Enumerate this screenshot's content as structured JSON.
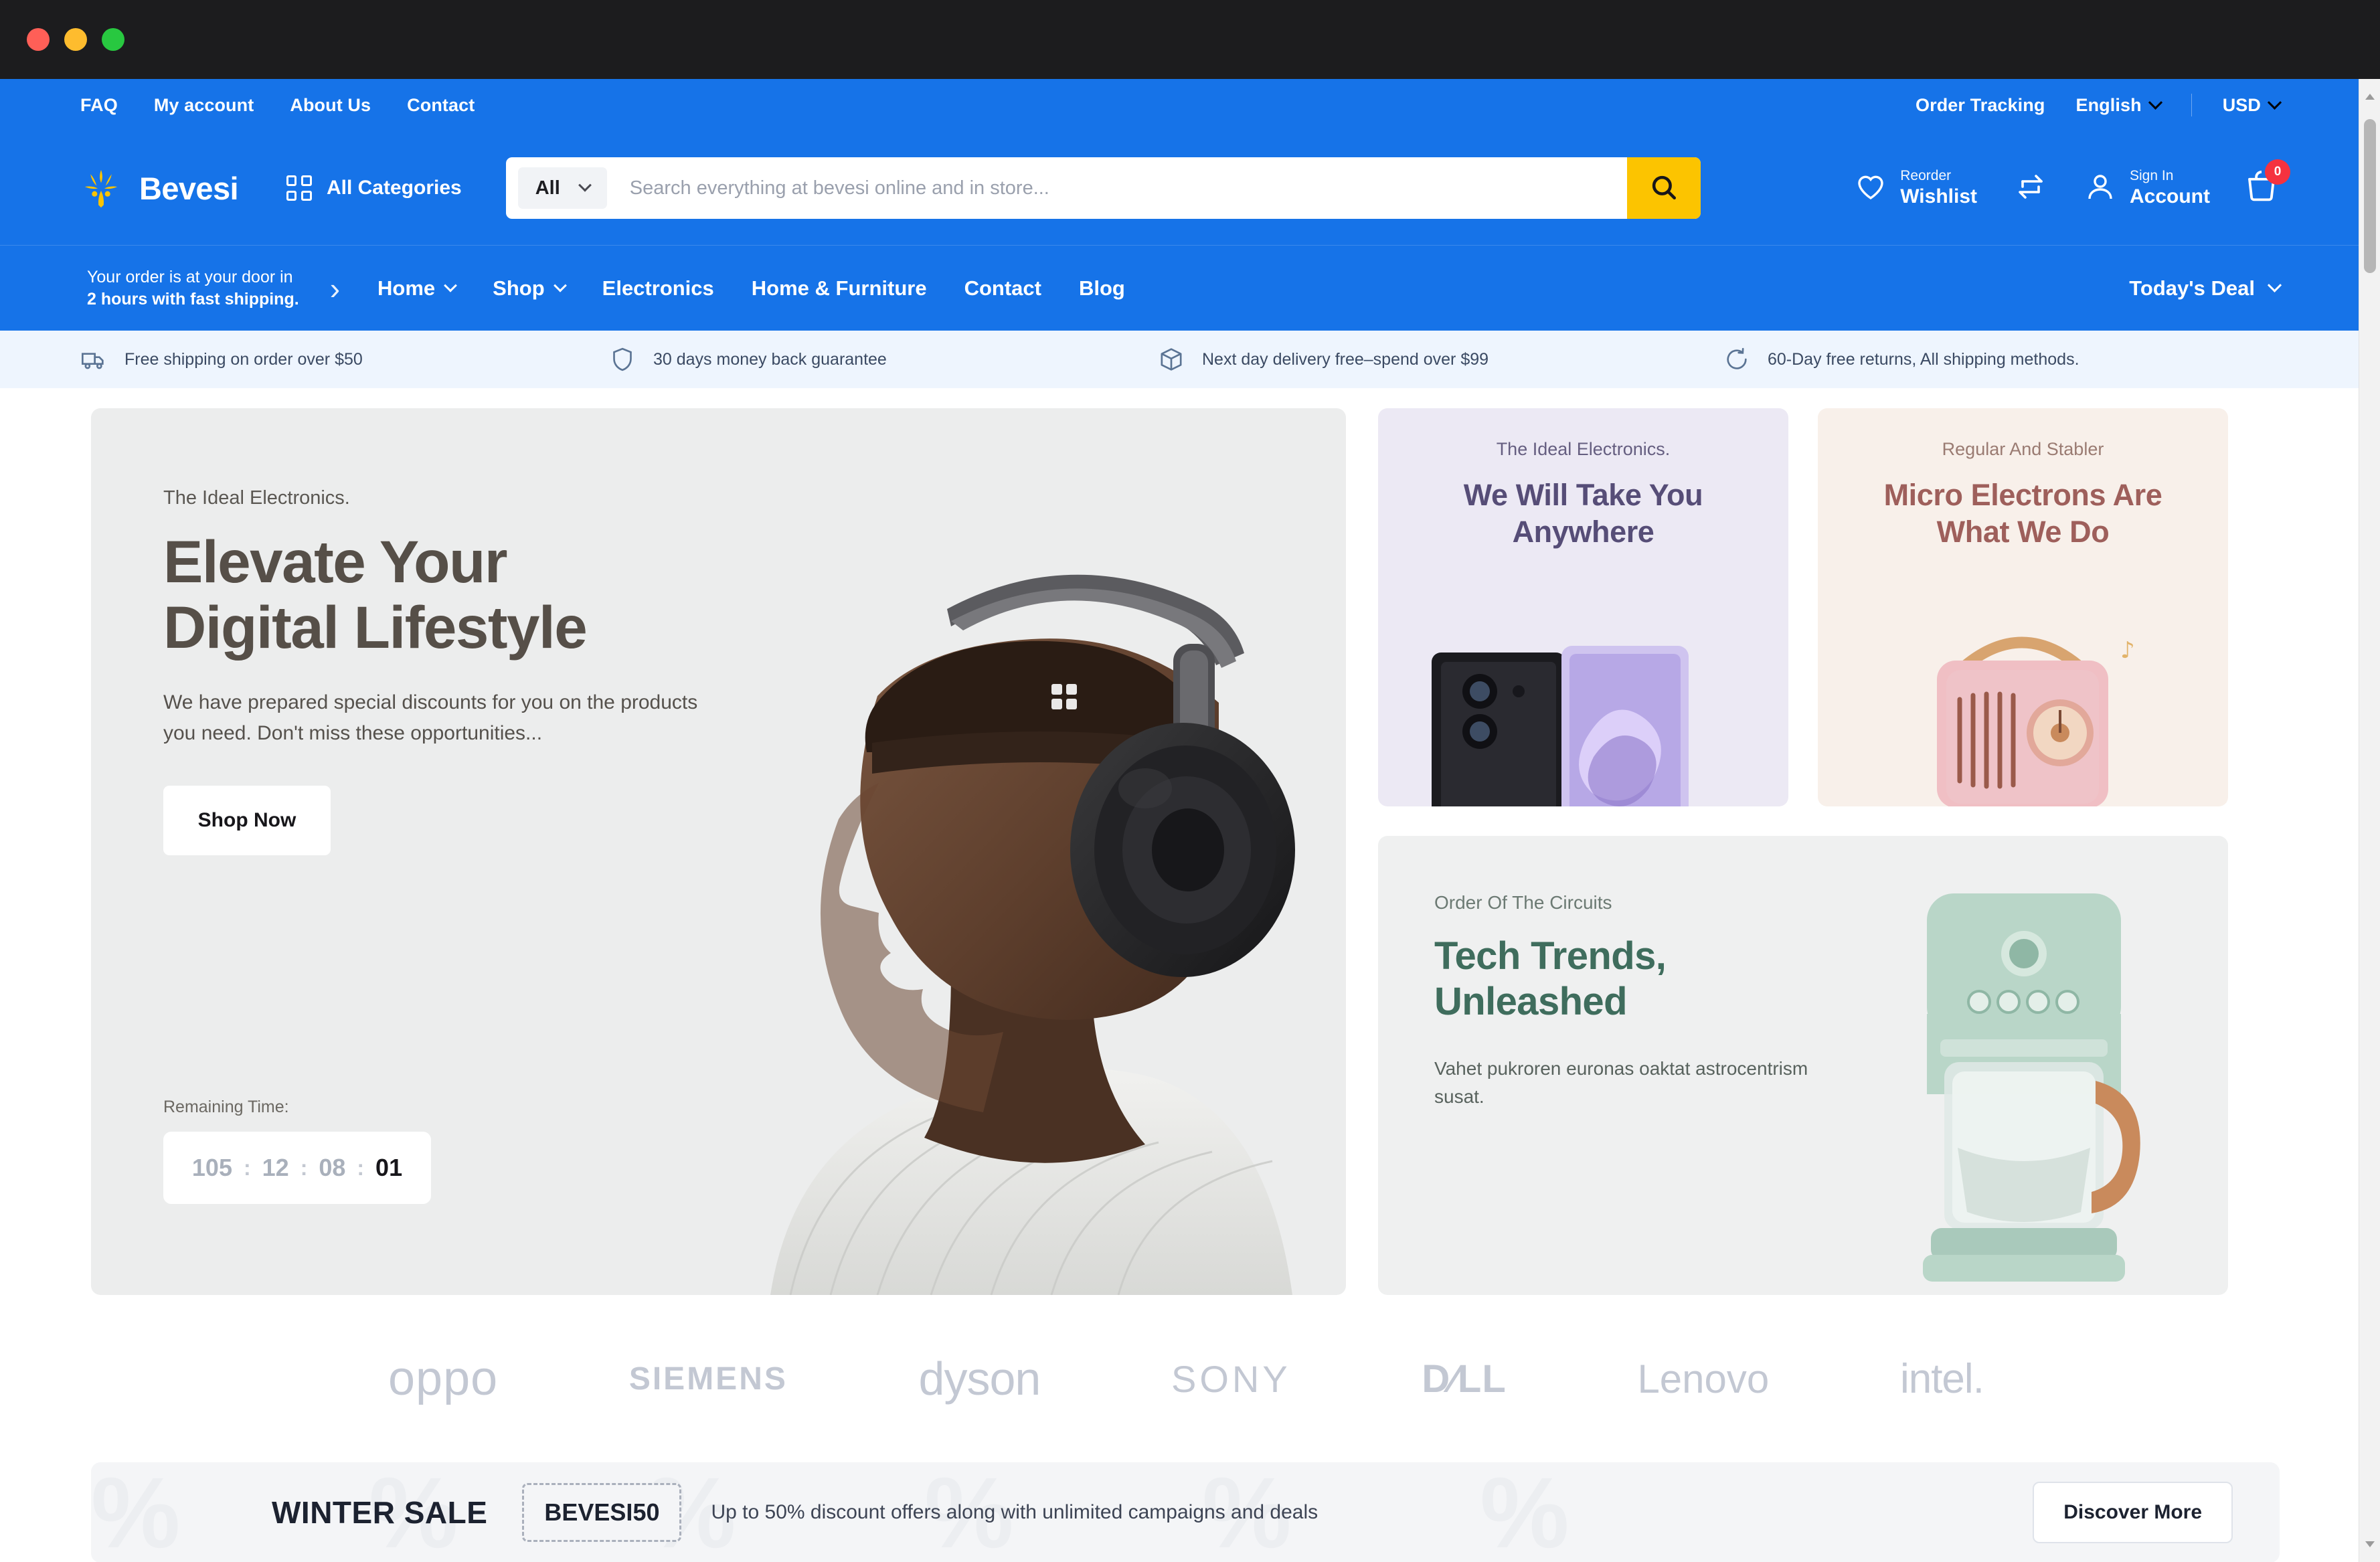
{
  "window": {
    "title": "Bevesi"
  },
  "topbar": {
    "links": [
      "FAQ",
      "My account",
      "About Us",
      "Contact"
    ],
    "order_tracking": "Order Tracking",
    "language": "English",
    "currency": "USD"
  },
  "header": {
    "brand": "Bevesi",
    "all_categories": "All Categories",
    "search": {
      "scope": "All",
      "placeholder": "Search everything at bevesi online and in store...",
      "value": ""
    },
    "actions": [
      {
        "top": "Reorder",
        "bottom": "Wishlist",
        "icon": "heart-icon"
      },
      {
        "top": "",
        "bottom": "",
        "icon": "compare-icon"
      },
      {
        "top": "Sign In",
        "bottom": "Account",
        "icon": "user-icon"
      }
    ],
    "cart": {
      "icon": "cart-icon",
      "count": "0"
    }
  },
  "nav": {
    "shipping_note_line1": "Your order is at your door in",
    "shipping_note_line2": "2 hours with fast shipping.",
    "menu": [
      {
        "label": "Home",
        "caret": true
      },
      {
        "label": "Shop",
        "caret": true
      },
      {
        "label": "Electronics",
        "caret": false
      },
      {
        "label": "Home & Furniture",
        "caret": false
      },
      {
        "label": "Contact",
        "caret": false
      },
      {
        "label": "Blog",
        "caret": false
      }
    ],
    "todays_deal": "Today's Deal"
  },
  "benefits": [
    {
      "icon": "truck-icon",
      "text": "Free shipping on order over $50"
    },
    {
      "icon": "shield-icon",
      "text": "30 days money back guarantee"
    },
    {
      "icon": "box-icon",
      "text": "Next day delivery free–spend over $99"
    },
    {
      "icon": "refresh-icon",
      "text": "60-Day free returns, All shipping methods."
    }
  ],
  "hero": {
    "kicker": "The Ideal Electronics.",
    "title_line1": "Elevate Your",
    "title_line2": "Digital Lifestyle",
    "description": "We have prepared special discounts for you on the products you need. Don't miss these opportunities...",
    "cta": "Shop Now",
    "timer_label": "Remaining Time:",
    "timer": {
      "days": "105",
      "hours": "12",
      "minutes": "08",
      "seconds": "01",
      "separator": ":"
    }
  },
  "promo_cards": [
    {
      "kicker": "The Ideal Electronics.",
      "title_line1": "We Will Take You",
      "title_line2": "Anywhere",
      "bg": "#ece9f4",
      "accent": "#564d77"
    },
    {
      "kicker": "Regular And Stabler",
      "title_line1": "Micro Electrons Are",
      "title_line2": "What We Do",
      "bg": "#f8f0ea",
      "accent": "#9e5f5b"
    }
  ],
  "wide_card": {
    "kicker": "Order Of The Circuits",
    "title_line1": "Tech Trends,",
    "title_line2": "Unleashed",
    "description": "Vahet pukroren euronas oaktat astrocentrism susat.",
    "accent": "#3f6d5d"
  },
  "brands": [
    "oppo",
    "SIEMENS",
    "dyson",
    "SONY",
    "D∕LL",
    "Lenovo",
    "intel."
  ],
  "winter_sale": {
    "ghost": "% % % % % %",
    "title": "WINTER SALE",
    "coupon": "BEVESI50",
    "description": "Up to 50% discount offers along with unlimited campaigns and deals",
    "cta": "Discover More"
  },
  "colors": {
    "brand_blue": "#1673e8",
    "accent_yellow": "#fcc400",
    "cart_badge_red": "#f5323f"
  }
}
